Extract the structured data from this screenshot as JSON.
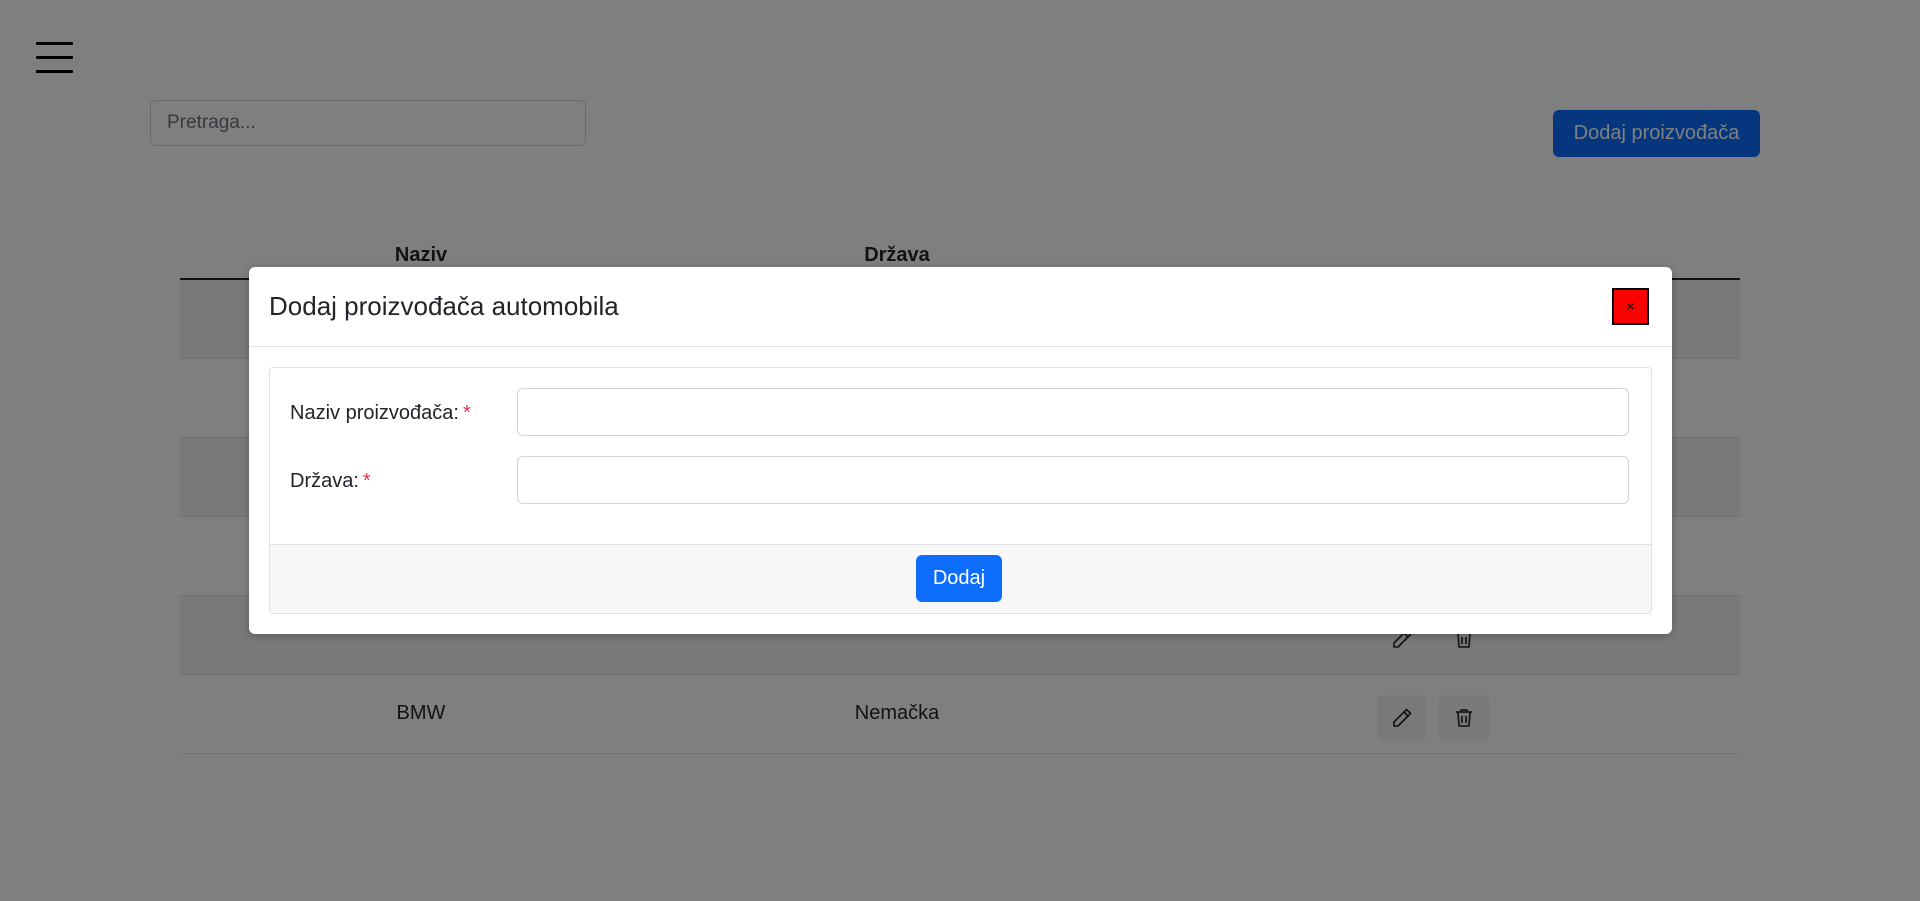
{
  "page": {
    "search_placeholder": "Pretraga...",
    "add_button_label": "Dodaj proizvođača"
  },
  "table": {
    "columns": [
      "Naziv",
      "Država"
    ],
    "rows": [
      {
        "naziv": "",
        "drzava": ""
      },
      {
        "naziv": "",
        "drzava": ""
      },
      {
        "naziv": "",
        "drzava": ""
      },
      {
        "naziv": "",
        "drzava": ""
      },
      {
        "naziv": "",
        "drzava": ""
      },
      {
        "naziv": "BMW",
        "drzava": "Nemačka"
      }
    ]
  },
  "modal": {
    "title": "Dodaj proizvođača automobila",
    "close_label": "×",
    "fields": [
      {
        "label": "Naziv proizvođača:",
        "required_mark": "*",
        "value": ""
      },
      {
        "label": "Država:",
        "required_mark": "*",
        "value": ""
      }
    ],
    "submit_label": "Dodaj"
  },
  "colors": {
    "primary": "#0d6efd",
    "required": "#dc3545",
    "close_button": "#ff0000"
  }
}
